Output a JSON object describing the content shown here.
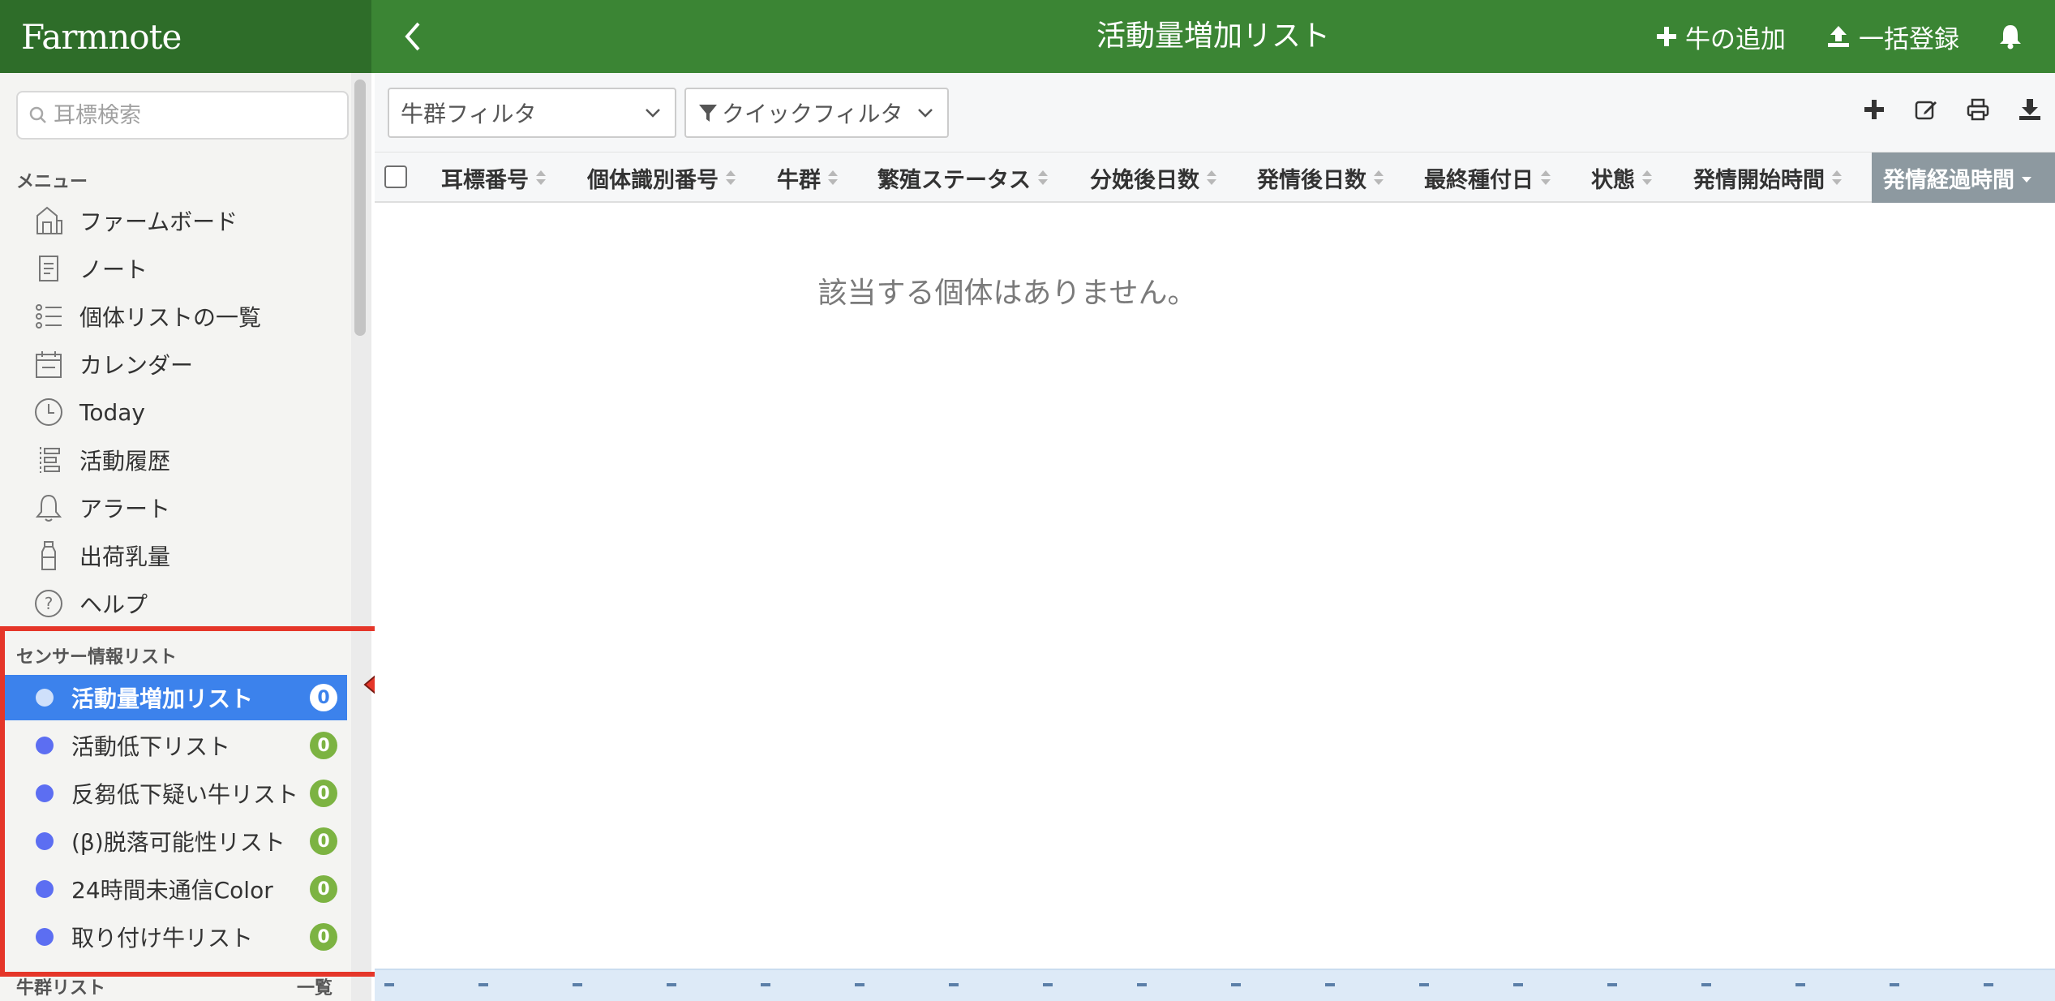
{
  "app": {
    "logo_text": "Farmnote",
    "page_title": "活動量増加リスト",
    "actions": {
      "add_cow": "牛の追加",
      "bulk_register": "一括登録"
    }
  },
  "sidebar": {
    "search": {
      "placeholder": "耳標検索",
      "value": ""
    },
    "menu_label": "メニュー",
    "menu_items": [
      {
        "label": "ファームボード",
        "icon": "farm-board-icon"
      },
      {
        "label": "ノート",
        "icon": "note-icon"
      },
      {
        "label": "個体リストの一覧",
        "icon": "list-icon"
      },
      {
        "label": "カレンダー",
        "icon": "calendar-icon"
      },
      {
        "label": "Today",
        "icon": "clock-icon"
      },
      {
        "label": "活動履歴",
        "icon": "history-icon"
      },
      {
        "label": "アラート",
        "icon": "bell-icon"
      },
      {
        "label": "出荷乳量",
        "icon": "milk-bottle-icon"
      },
      {
        "label": "ヘルプ",
        "icon": "help-icon"
      }
    ],
    "sensor_label": "センサー情報リスト",
    "sensor_items": [
      {
        "label": "活動量増加リスト",
        "count": "0",
        "active": true
      },
      {
        "label": "活動低下リスト",
        "count": "0",
        "active": false
      },
      {
        "label": "反芻低下疑い牛リスト",
        "count": "0",
        "active": false
      },
      {
        "label": "(β)脱落可能性リスト",
        "count": "0",
        "active": false
      },
      {
        "label": "24時間未通信Color",
        "count": "0",
        "active": false
      },
      {
        "label": "取り付け牛リスト",
        "count": "0",
        "active": false
      }
    ],
    "herd_label": "牛群リスト",
    "herd_all": "一覧"
  },
  "toolbar": {
    "herd_filter": "牛群フィルタ",
    "quick_filter": "クイックフィルタ"
  },
  "table": {
    "columns": [
      "耳標番号",
      "個体識別番号",
      "牛群",
      "繁殖ステータス",
      "分娩後日数",
      "発情後日数",
      "最終種付日",
      "状態",
      "発情開始時間",
      "発情経過時間"
    ],
    "sorted_column": "発情経過時間",
    "empty_message": "該当する個体はありません。"
  },
  "colors": {
    "header_green": "#3b8534",
    "logo_green": "#2e6d29",
    "active_blue": "#3c82ec",
    "badge_green": "#7cb342",
    "dot_blue": "#5c6ef2",
    "highlight_red": "#e53629"
  }
}
